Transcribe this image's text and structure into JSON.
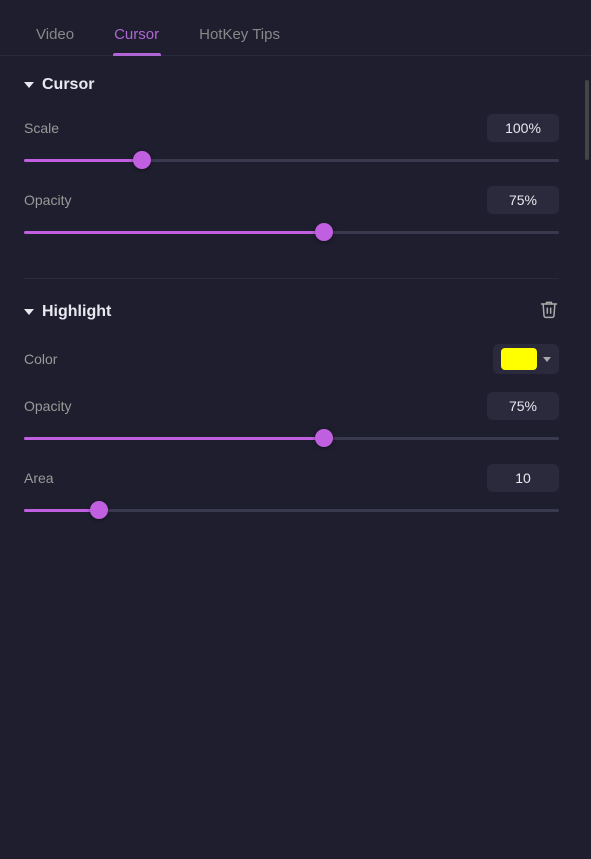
{
  "tabs": [
    {
      "id": "video",
      "label": "Video",
      "active": false
    },
    {
      "id": "cursor",
      "label": "Cursor",
      "active": true
    },
    {
      "id": "hotkey-tips",
      "label": "HotKey Tips",
      "active": false
    }
  ],
  "cursor_section": {
    "title": "Cursor",
    "scale": {
      "label": "Scale",
      "value": "100%",
      "fill_percent": 22
    },
    "opacity": {
      "label": "Opacity",
      "value": "75%",
      "fill_percent": 56
    }
  },
  "highlight_section": {
    "title": "Highlight",
    "color": {
      "label": "Color",
      "swatch_color": "#ffff00"
    },
    "opacity": {
      "label": "Opacity",
      "value": "75%",
      "fill_percent": 56
    },
    "area": {
      "label": "Area",
      "value": "10",
      "fill_percent": 14
    }
  }
}
